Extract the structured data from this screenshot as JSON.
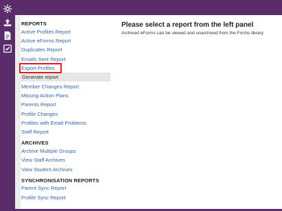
{
  "sidebar": {
    "sections": [
      {
        "title": "REPORTS",
        "items": [
          {
            "label": "Active Profiles Report"
          },
          {
            "label": "Active eForms Report"
          },
          {
            "label": "Duplicates Report"
          },
          {
            "label": "Emails Sent Report"
          },
          {
            "label": "Export Profiles"
          },
          {
            "label": "Generate report"
          },
          {
            "label": "Member Changes Report"
          },
          {
            "label": "Missing Action Plans"
          },
          {
            "label": "Parents Report"
          },
          {
            "label": "Profile Changes"
          },
          {
            "label": "Profiles with Email Problems"
          },
          {
            "label": "Staff Report"
          }
        ]
      },
      {
        "title": "ARCHIVES",
        "items": [
          {
            "label": "Archive Multiple Groups"
          },
          {
            "label": "View Staff Archives"
          },
          {
            "label": "View Student Archives"
          }
        ]
      },
      {
        "title": "SYNCHRONISATION REPORTS",
        "items": [
          {
            "label": "Parent Sync Report"
          },
          {
            "label": "Profile Sync Report"
          }
        ]
      }
    ]
  },
  "main": {
    "title": "Please select a report from the left panel",
    "description": "Archived eForms can be viewed and unarchived from the Forms library"
  },
  "rail": {
    "icons": [
      "settings-icon",
      "upload-icon",
      "document-icon",
      "checklist-icon"
    ]
  },
  "colors": {
    "nav_purple": "#5a2d6a",
    "link_blue": "#3566a8",
    "highlight_red": "#e21b1b"
  }
}
